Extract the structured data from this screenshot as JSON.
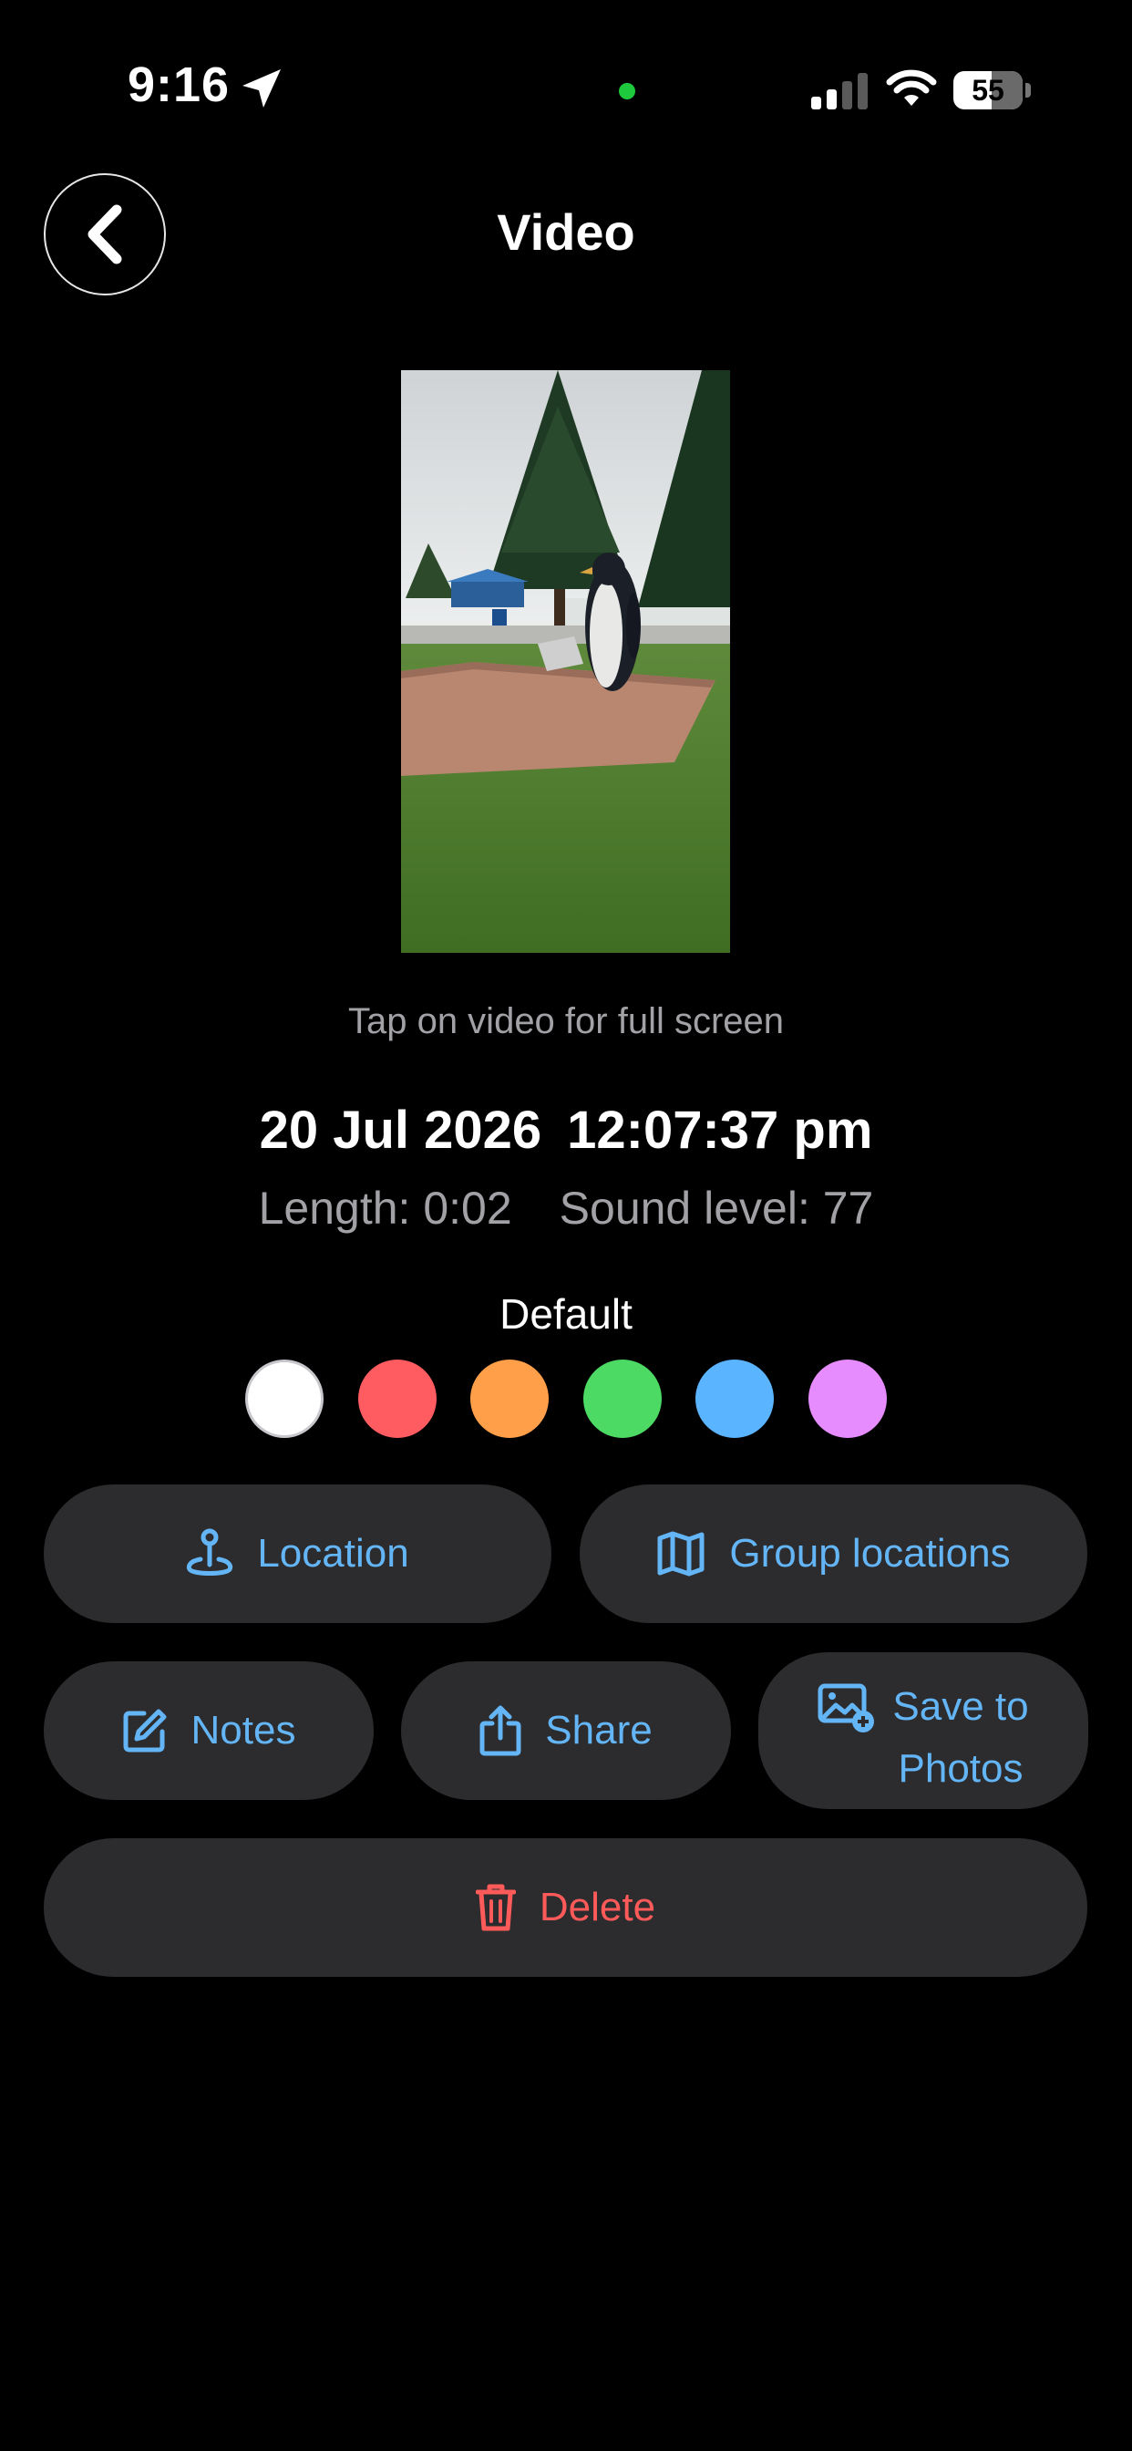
{
  "status_bar": {
    "time": "9:16",
    "battery": "55"
  },
  "header": {
    "title": "Video"
  },
  "video": {
    "hint": "Tap on video for full screen",
    "date": "20 Jul 2026",
    "time": "12:07:37 pm",
    "length": "Length: 0:02",
    "sound_level": "Sound level: 77"
  },
  "color_picker": {
    "label": "Default",
    "colors": [
      "#ffffff",
      "#ff5c61",
      "#ff9f4a",
      "#4cd964",
      "#5ab4ff",
      "#e68cff"
    ]
  },
  "actions": {
    "location": "Location",
    "group_locations": "Group locations",
    "notes": "Notes",
    "share": "Share",
    "save_line1": "Save to",
    "save_line2": "Photos",
    "delete": "Delete"
  },
  "colors": {
    "accent": "#64b5f6",
    "danger": "#ff5a5a",
    "button_bg": "#2c2c2e"
  }
}
